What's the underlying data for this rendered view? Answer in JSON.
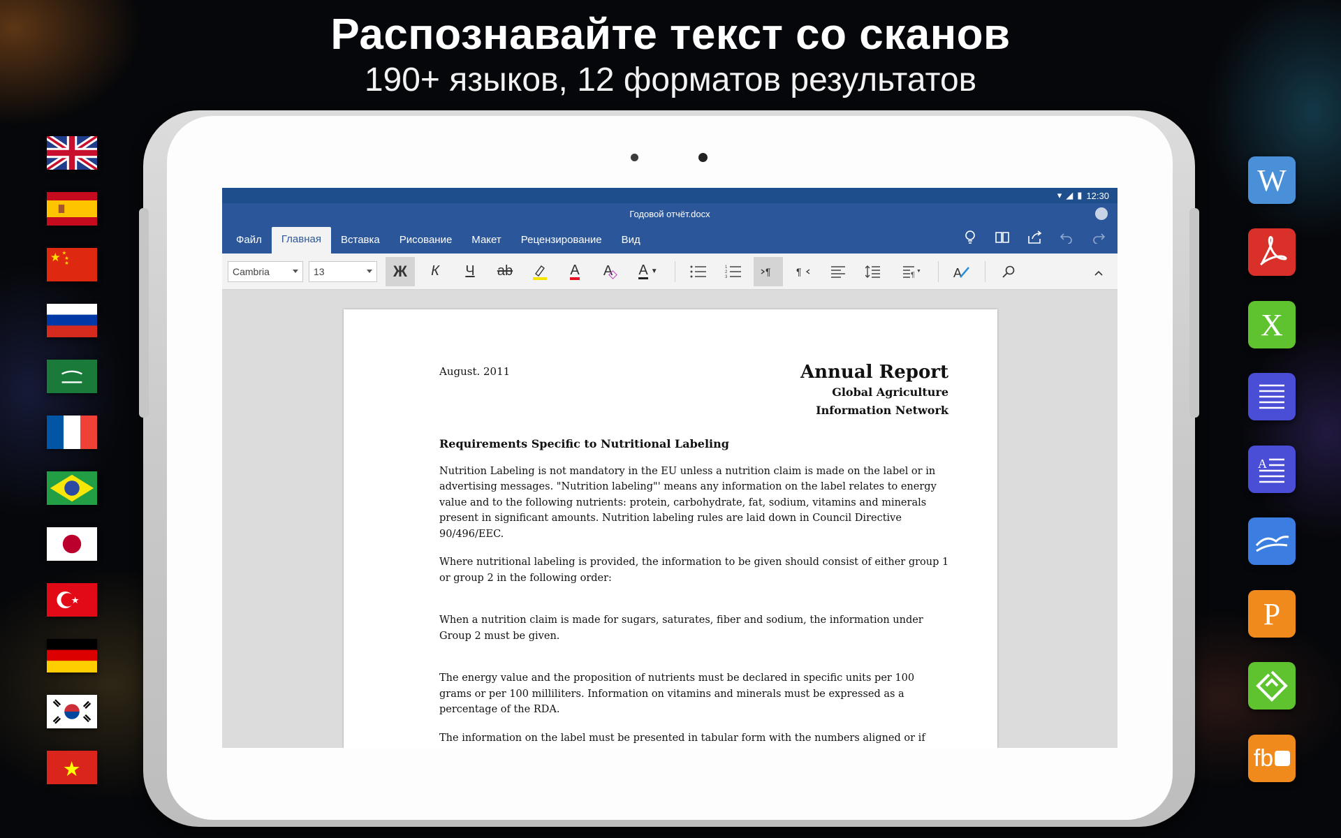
{
  "promo": {
    "headline": "Распознавайте текст со сканов",
    "subline": "190+ языков, 12 форматов результатов"
  },
  "flags": [
    "uk-flag",
    "spain-flag",
    "china-flag",
    "russia-flag",
    "saudi-arabia-flag",
    "france-flag",
    "brazil-flag",
    "japan-flag",
    "turkey-flag",
    "germany-flag",
    "south-korea-flag",
    "vietnam-flag"
  ],
  "formats": [
    {
      "icon": "word-icon",
      "glyph": "W",
      "color": "#4a90d9"
    },
    {
      "icon": "pdf-icon",
      "glyph": "",
      "color": "#d9302a"
    },
    {
      "icon": "excel-icon",
      "glyph": "X",
      "color": "#5fc32f"
    },
    {
      "icon": "text-icon",
      "glyph": "",
      "color": "#4a4ed6"
    },
    {
      "icon": "rtf-icon",
      "glyph": "A",
      "color": "#4a4ed6"
    },
    {
      "icon": "openoffice-icon",
      "glyph": "",
      "color": "#3b7de0"
    },
    {
      "icon": "powerpoint-icon",
      "glyph": "P",
      "color": "#f08a1c"
    },
    {
      "icon": "epub-icon",
      "glyph": "",
      "color": "#5fc32f"
    },
    {
      "icon": "fb2-icon",
      "glyph": "fb",
      "color": "#f08a1c"
    }
  ],
  "status": {
    "time": "12:30"
  },
  "document": {
    "filename": "Годовой отчёт.docx"
  },
  "menu": {
    "items": [
      "Файл",
      "Главная",
      "Вставка",
      "Рисование",
      "Макет",
      "Рецензирование",
      "Вид"
    ],
    "active": "Главная"
  },
  "toolbar": {
    "font": "Cambria",
    "size": "13",
    "bold": "Ж",
    "italic": "К",
    "underline": "Ч",
    "strike": "ab",
    "font_color": "A",
    "clear_format": "A",
    "text_color": "A"
  },
  "page": {
    "date": "August. 2011",
    "title": "Annual Report",
    "subtitle1": "Global Agriculture",
    "subtitle2": "Information Network",
    "heading": "Requirements Specific to Nutritional Labeling",
    "p1": "Nutrition Labeling is not mandatory in the EU unless a nutrition claim is made on the label or in advertising messages. \"Nutrition labeling\"' means any information on the label relates to energy value and to the following nutrients: protein, carbohydrate, fat, sodium, vitamins and minerals present in significant amounts. Nutrition labeling rules are laid down in Council Directive 90/496/EEC.",
    "p2": "Where nutritional labeling is provided, the information to be given should consist of either group 1 or group 2 in the following order:",
    "p3": "When a nutrition claim is made for sugars, saturates, fiber and sodium, the information under Group 2 must be given.",
    "p4": "The energy value and the proposition of nutrients must be declared in specific units per 100 grams or per 100 milliliters. Information on vitamins and minerals must be expressed as a percentage of the RDA.",
    "p5": "The information on the label must be presented in tabular form with the numbers aligned or if space does not permit, in linear form in a language easily understood by the purchaser."
  }
}
